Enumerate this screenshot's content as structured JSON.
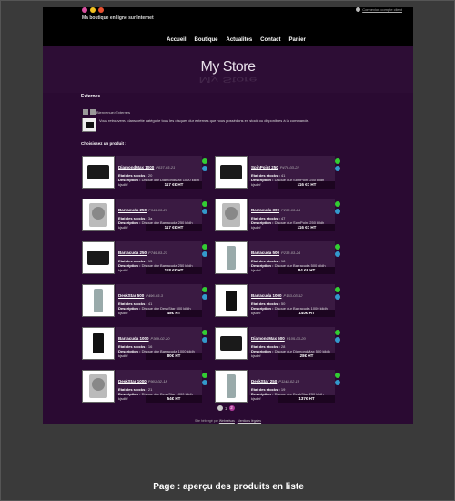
{
  "header": {
    "tagline": "Ma boutique en ligne sur Internet",
    "login_link": "Connexion compte client",
    "flag_colors": [
      "#d94fa0",
      "#f0c020",
      "#e85030"
    ]
  },
  "nav": [
    "Accueil",
    "Boutique",
    "Actualités",
    "Contact",
    "Panier"
  ],
  "logo": "My Store",
  "section": {
    "title": "Externes",
    "breadcrumb": "Bienvenue>Externes",
    "description": "Vous retrouverez dans cette catégorie tous les disques dur externes que nous possédons en stock ou disponibles à la commande.",
    "choose": "Choisissez un produit :"
  },
  "labels": {
    "stock": "Etat des stocks :",
    "desc": "Description :"
  },
  "products": [
    {
      "name": "DiamondMax 1000",
      "ref": "P037-03-21",
      "stock": "20",
      "desc": "Disque dur DiamondMax 1000 kjldh kjsdhf",
      "price": "117 €€ HT",
      "img": "box"
    },
    {
      "name": "SpinPoint 250",
      "ref": "P470-03-22",
      "stock": "41",
      "desc": "Disque dur SpinPoint 250 kjldh kjsdhf",
      "price": "116 €€ HT",
      "img": "box"
    },
    {
      "name": "Barracuda 250",
      "ref": "P349-03-23",
      "stock": "3a",
      "desc": "Disque dur Barracuda 250 kjldh kjsdhf",
      "price": "117 €€ HT",
      "img": "disk"
    },
    {
      "name": "Barracuda 300",
      "ref": "P238-03-24",
      "stock": "47",
      "desc": "Disque dur SpinPoint 250 kjldh kjsdhf",
      "price": "116 €€ HT",
      "img": "disk"
    },
    {
      "name": "Barracuda 250",
      "ref": "P749-03-23",
      "stock": "15",
      "desc": "Disque dur Barracuda 250 kjldh kjsdhf",
      "price": "118 €€ HT",
      "img": "box"
    },
    {
      "name": "Barracuda 500",
      "ref": "P238-03-24",
      "stock": "18",
      "desc": "Disque dur Barracuda 500 kjldh kjsdhf",
      "price": "84 €€ HT",
      "img": "tower"
    },
    {
      "name": "DeskStar 500",
      "ref": "P496-03-3",
      "stock": "41",
      "desc": "Disque dur DeskStar 500 kjldh kjsdhf",
      "price": "48€ HT",
      "img": "tower"
    },
    {
      "name": "Barracuda 1000",
      "ref": "P163-03-12",
      "stock": "50",
      "desc": "Disque dur Barracuda 1000 kjldh kjsdhf",
      "price": "140€ HT",
      "img": "slim"
    },
    {
      "name": "Barracuda 1000",
      "ref": "P369-02-20",
      "stock": "16",
      "desc": "Disque dur Barracuda 1000 kjldh kjsdhf",
      "price": "80€ HT",
      "img": "slim"
    },
    {
      "name": "DiamondMax 500",
      "ref": "P105-03-20",
      "stock": "28",
      "desc": "Disque dur DiamondMax 500 kjldh kjsdhf",
      "price": "28€ HT",
      "img": "box"
    },
    {
      "name": "DeskStar 1000",
      "ref": "P901-02-18",
      "stock": "21",
      "desc": "Disque dur DeskStar 1000 kjldh kjsdhf",
      "price": "54€ HT",
      "img": "disk"
    },
    {
      "name": "DeskStar 250",
      "ref": "P1148-02-18",
      "stock": "19",
      "desc": "Disque dur DeskStar 250 kjldh kjsdhf",
      "price": "137€ HT",
      "img": "tower"
    }
  ],
  "pagination": {
    "pages": [
      "1",
      "2"
    ],
    "current": "2"
  },
  "footer": {
    "prefix": "Site hébergé par",
    "host": "Webselvas",
    "legal": "Mentions légales"
  },
  "caption": "Page : aperçu des produits en liste"
}
